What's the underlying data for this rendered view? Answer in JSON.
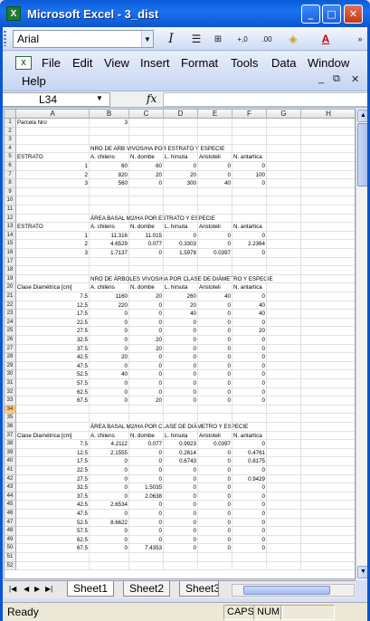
{
  "window": {
    "title": "Microsoft Excel - 3_dist",
    "app_icon": "X"
  },
  "toolbar": {
    "font": "Arial",
    "italic": "I",
    "decimal_inc": "+,0\n.00",
    "decimal_dec": ".00\n+,0"
  },
  "menu": {
    "file": "File",
    "edit": "Edit",
    "view": "View",
    "insert": "Insert",
    "format": "Format",
    "tools": "Tools",
    "data": "Data",
    "window": "Window",
    "help": "Help"
  },
  "formula": {
    "namebox": "L34",
    "fx": "fx",
    "value": ""
  },
  "columns": [
    "A",
    "B",
    "C",
    "D",
    "E",
    "F",
    "G",
    "H"
  ],
  "rows": [
    [
      "1",
      "Parcela Nro",
      "3",
      "",
      "",
      "",
      "",
      "",
      ""
    ],
    [
      "2",
      "",
      "",
      "",
      "",
      "",
      "",
      "",
      ""
    ],
    [
      "3",
      "",
      "",
      "",
      "",
      "",
      "",
      "",
      ""
    ],
    [
      "4",
      "",
      "NRO DE ARB VIVOS/HA POR ESTRATO Y ESPECIE",
      "",
      "",
      "",
      "",
      "",
      ""
    ],
    [
      "5",
      "ESTRATO",
      "A. chilens",
      "N. dombe",
      "L. hirsuta",
      "Aristoteli",
      "N. antartica",
      "",
      ""
    ],
    [
      "6",
      "1",
      "60",
      "60",
      "0",
      "0",
      "0",
      "",
      ""
    ],
    [
      "7",
      "2",
      "820",
      "20",
      "20",
      "0",
      "100",
      "",
      ""
    ],
    [
      "8",
      "3",
      "560",
      "0",
      "300",
      "40",
      "0",
      "",
      ""
    ],
    [
      "9",
      "",
      "",
      "",
      "",
      "",
      "",
      "",
      ""
    ],
    [
      "10",
      "",
      "",
      "",
      "",
      "",
      "",
      "",
      ""
    ],
    [
      "11",
      "",
      "",
      "",
      "",
      "",
      "",
      "",
      ""
    ],
    [
      "12",
      "",
      "ÁREA BASAL M2/HA POR ESTRATO Y ESPECIE",
      "",
      "",
      "",
      "",
      "",
      ""
    ],
    [
      "13",
      "ESTRATO",
      "A. chilens",
      "N. dombe",
      "L. hirsuta",
      "Aristoteli",
      "N. antartica",
      "",
      ""
    ],
    [
      "14",
      "1",
      "11.316",
      "11.015",
      "0",
      "0",
      "0",
      "",
      ""
    ],
    [
      "15",
      "2",
      "4.6529",
      "0.077",
      "0.3303",
      "0",
      "2.2364",
      "",
      ""
    ],
    [
      "16",
      "3",
      "1.7137",
      "0",
      "1.5978",
      "0.0397",
      "0",
      "",
      ""
    ],
    [
      "17",
      "",
      "",
      "",
      "",
      "",
      "",
      "",
      ""
    ],
    [
      "18",
      "",
      "",
      "",
      "",
      "",
      "",
      "",
      ""
    ],
    [
      "19",
      "",
      "NRO DE ÁRBOLES VIVOS/HA POR CLASE DE DIÁMETRO Y ESPECIE",
      "",
      "",
      "",
      "",
      "",
      ""
    ],
    [
      "20",
      "Clase Diamétrica [cm]",
      "A. chilens",
      "N. dombe",
      "L. hirsuta",
      "Aristoteli",
      "N. antartica",
      "",
      ""
    ],
    [
      "21",
      "7.5",
      "1160",
      "20",
      "260",
      "40",
      "0",
      "",
      ""
    ],
    [
      "22",
      "12.5",
      "220",
      "0",
      "20",
      "0",
      "40",
      "",
      ""
    ],
    [
      "23",
      "17.5",
      "0",
      "0",
      "40",
      "0",
      "40",
      "",
      ""
    ],
    [
      "24",
      "22.5",
      "0",
      "0",
      "0",
      "0",
      "0",
      "",
      ""
    ],
    [
      "25",
      "27.5",
      "0",
      "0",
      "0",
      "0",
      "20",
      "",
      ""
    ],
    [
      "26",
      "32.5",
      "0",
      "20",
      "0",
      "0",
      "0",
      "",
      ""
    ],
    [
      "27",
      "37.5",
      "0",
      "20",
      "0",
      "0",
      "0",
      "",
      ""
    ],
    [
      "28",
      "42.5",
      "20",
      "0",
      "0",
      "0",
      "0",
      "",
      ""
    ],
    [
      "29",
      "47.5",
      "0",
      "0",
      "0",
      "0",
      "0",
      "",
      ""
    ],
    [
      "30",
      "52.5",
      "40",
      "0",
      "0",
      "0",
      "0",
      "",
      ""
    ],
    [
      "31",
      "57.5",
      "0",
      "0",
      "0",
      "0",
      "0",
      "",
      ""
    ],
    [
      "32",
      "62.5",
      "0",
      "0",
      "0",
      "0",
      "0",
      "",
      ""
    ],
    [
      "33",
      "67.5",
      "0",
      "20",
      "0",
      "0",
      "0",
      "",
      ""
    ],
    [
      "34",
      "",
      "",
      "",
      "",
      "",
      "",
      "",
      ""
    ],
    [
      "35",
      "",
      "",
      "",
      "",
      "",
      "",
      "",
      ""
    ],
    [
      "36",
      "",
      "ÁREA BASAL M2/HA POR CLASE DE DIÁMETRO Y ESPECIE",
      "",
      "",
      "",
      "",
      "",
      ""
    ],
    [
      "37",
      "Clase Diamétrica [cm]",
      "A. chilens",
      "N. dombe",
      "L. hirsuta",
      "Aristoteli",
      "N. antartica",
      "",
      ""
    ],
    [
      "38",
      "7.5",
      "4.2112",
      "0.077",
      "0.9923",
      "0.0397",
      "0",
      "",
      ""
    ],
    [
      "39",
      "12.5",
      "2.1555",
      "0",
      "0.2614",
      "0",
      "0.4761",
      "",
      ""
    ],
    [
      "40",
      "17.5",
      "0",
      "0",
      "0.6743",
      "0",
      "0.8175",
      "",
      ""
    ],
    [
      "41",
      "22.5",
      "0",
      "0",
      "0",
      "0",
      "0",
      "",
      ""
    ],
    [
      "42",
      "27.5",
      "0",
      "0",
      "0",
      "0",
      "0.9429",
      "",
      ""
    ],
    [
      "43",
      "32.5",
      "0",
      "1.5035",
      "0",
      "0",
      "0",
      "",
      ""
    ],
    [
      "44",
      "37.5",
      "0",
      "2.0638",
      "0",
      "0",
      "0",
      "",
      ""
    ],
    [
      "45",
      "42.5",
      "2.6534",
      "0",
      "0",
      "0",
      "0",
      "",
      ""
    ],
    [
      "46",
      "47.5",
      "0",
      "0",
      "0",
      "0",
      "0",
      "",
      ""
    ],
    [
      "47",
      "52.5",
      "8.6622",
      "0",
      "0",
      "0",
      "0",
      "",
      ""
    ],
    [
      "48",
      "57.5",
      "0",
      "0",
      "0",
      "0",
      "0",
      "",
      ""
    ],
    [
      "49",
      "62.5",
      "0",
      "0",
      "0",
      "0",
      "0",
      "",
      ""
    ],
    [
      "50",
      "67.5",
      "0",
      "7.4353",
      "0",
      "0",
      "0",
      "",
      ""
    ],
    [
      "51",
      "",
      "",
      "",
      "",
      "",
      "",
      "",
      ""
    ],
    [
      "52",
      "",
      "",
      "",
      "",
      "",
      "",
      "",
      ""
    ]
  ],
  "sheets": [
    "Sheet1",
    "Sheet2",
    "Sheet3"
  ],
  "status": {
    "ready": "Ready",
    "caps": "CAPS",
    "num": "NUM"
  }
}
